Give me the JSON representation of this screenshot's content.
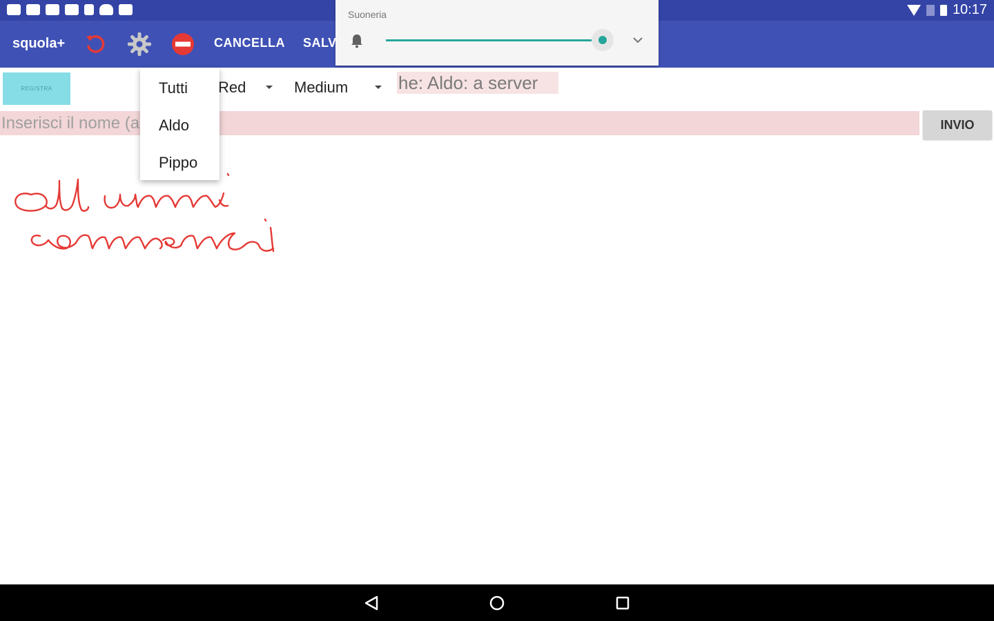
{
  "status_bar": {
    "time": "10:17"
  },
  "toolbar": {
    "title": "squola+",
    "cancel_label": "CANCELLA",
    "save_label": "SALVA"
  },
  "volume": {
    "label": "Suoneria",
    "level_percent": 95,
    "accent_color": "#26a69a"
  },
  "controls": {
    "registra_label": "REGISTRA",
    "color_value": "Red",
    "size_value": "Medium",
    "server_message": "he: Aldo: a server",
    "name_placeholder": "Inserisci il nome (anche Tutti)",
    "send_label": "INVIO"
  },
  "recipient_menu": {
    "items": [
      "Tutti",
      "Aldo",
      "Pippo"
    ]
  },
  "colors": {
    "appbar": "#3f51b5",
    "statusbar": "#3344a6",
    "ink": "#e53935"
  }
}
